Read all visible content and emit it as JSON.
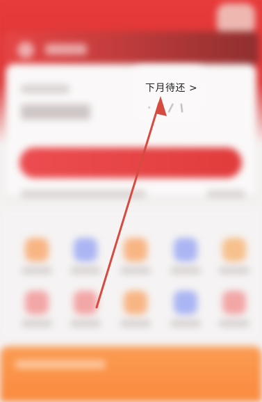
{
  "card": {
    "pending_repay_link": "下月待还 >",
    "pending_amount_partial": "· · / \\"
  },
  "annotation": {
    "arrow_color": "#d64a40"
  },
  "colors": {
    "header_red": "#e83a3a",
    "button_red": "#e13c3c",
    "banner_orange": "#fa8a3e",
    "background": "#f4f1f1"
  },
  "grid": {
    "icons": [
      {
        "name": "orange-tile-icon",
        "color": "#f8b584"
      },
      {
        "name": "blue-tile-icon",
        "color": "#aab5f3"
      },
      {
        "name": "orange-tile-icon",
        "color": "#f8b584"
      },
      {
        "name": "blue-tile-icon",
        "color": "#aab5f3"
      },
      {
        "name": "orange-tile-icon",
        "color": "#f7c08c"
      },
      {
        "name": "red-tile-icon",
        "color": "#f3a6a6"
      },
      {
        "name": "red-tile-icon",
        "color": "#f3a6a6"
      },
      {
        "name": "orange-tile-icon",
        "color": "#f8b584"
      },
      {
        "name": "blue-tile-icon",
        "color": "#aab5f3"
      },
      {
        "name": "red-tile-icon",
        "color": "#f3a6a6"
      }
    ]
  }
}
